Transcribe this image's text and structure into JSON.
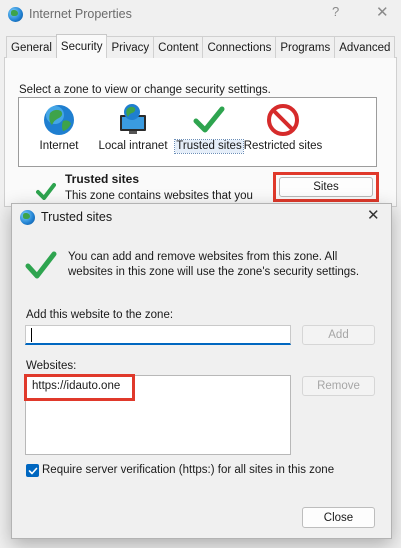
{
  "background_window": {
    "title": "Internet Properties",
    "help_glyph": "?",
    "close_glyph": "✕",
    "tabs": [
      {
        "label": "General",
        "active": false
      },
      {
        "label": "Security",
        "active": true
      },
      {
        "label": "Privacy",
        "active": false
      },
      {
        "label": "Content",
        "active": false
      },
      {
        "label": "Connections",
        "active": false
      },
      {
        "label": "Programs",
        "active": false
      },
      {
        "label": "Advanced",
        "active": false
      }
    ],
    "zone_prompt": "Select a zone to view or change security settings.",
    "zones": [
      {
        "label": "Internet",
        "icon": "globe-icon"
      },
      {
        "label": "Local intranet",
        "icon": "monitor-globe-icon"
      },
      {
        "label": "Trusted sites",
        "icon": "checkmark-icon",
        "selected": true
      },
      {
        "label": "Restricted sites",
        "icon": "no-entry-icon"
      }
    ],
    "selected_zone_title": "Trusted sites",
    "selected_zone_desc": "This zone contains websites that you",
    "sites_button": "Sites"
  },
  "dialog": {
    "title": "Trusted sites",
    "close_glyph": "✕",
    "info_text": "You can add and remove websites from this zone. All websites in this zone will use the zone's security settings.",
    "add_label": "Add this website to the zone:",
    "add_input_value": "",
    "add_button": "Add",
    "websites_label": "Websites:",
    "websites": [
      "https://idauto.one"
    ],
    "remove_button": "Remove",
    "verification_label": "Require server verification (https:) for all sites in this zone",
    "verification_checked": true,
    "close_button": "Close"
  },
  "colors": {
    "highlight_red": "#e0392b",
    "accent_blue": "#0067c0",
    "check_green": "#2ea44f"
  }
}
